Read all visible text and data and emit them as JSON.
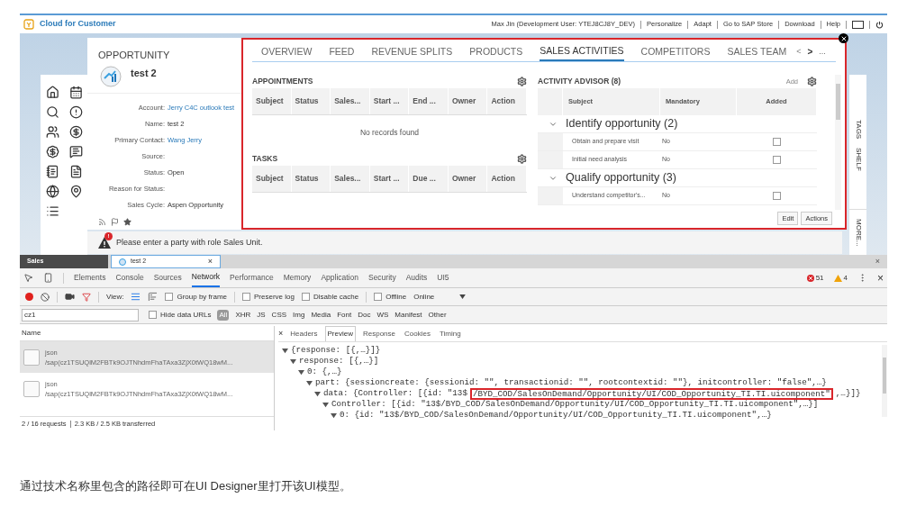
{
  "header": {
    "logo": "Cloud for Customer",
    "links": [
      "Max Jin (Development User: YTEJ8CJ8Y_DEV)",
      "Personalize",
      "Adapt",
      "Go to SAP Store",
      "Download",
      "Help"
    ]
  },
  "opportunity": {
    "heading": "OPPORTUNITY",
    "title": "test 2",
    "fields": [
      {
        "label": "Account:",
        "value": "Jerry C4C outlook test",
        "link": true
      },
      {
        "label": "Name:",
        "value": "test 2",
        "link": false
      },
      {
        "label": "Primary Contact:",
        "value": "Wang Jerry",
        "link": true
      },
      {
        "label": "Source:"
      },
      {
        "label": "Status:",
        "value": "Open",
        "link": false
      },
      {
        "label": "Reason for Status:"
      },
      {
        "label": "Sales Cycle:",
        "value": "Aspen Opportunity",
        "link": false
      }
    ]
  },
  "tabs": [
    {
      "label": "OVERVIEW",
      "selected": false
    },
    {
      "label": "FEED",
      "selected": false
    },
    {
      "label": "REVENUE SPLITS",
      "selected": false
    },
    {
      "label": "PRODUCTS",
      "selected": false
    },
    {
      "label": "SALES ACTIVITIES",
      "selected": true
    },
    {
      "label": "COMPETITORS",
      "selected": false
    },
    {
      "label": "SALES TEAM",
      "selected": false
    }
  ],
  "tab_nav": [
    "<",
    ">",
    "..."
  ],
  "appointments": {
    "title": "APPOINTMENTS",
    "columns": [
      "Subject",
      "Status",
      "Sales...",
      "Start ...",
      "End ...",
      "Owner",
      "Action"
    ],
    "empty": "No records found"
  },
  "tasks": {
    "title": "TASKS",
    "columns": [
      "Subject",
      "Status",
      "Sales...",
      "Start ...",
      "Due ...",
      "Owner",
      "Action"
    ]
  },
  "activity_advisor": {
    "title": "ACTIVITY ADVISOR (8)",
    "add": "Add",
    "columns": [
      "Subject",
      "Mandatory",
      "Added"
    ],
    "groups": [
      {
        "title": "Identify opportunity (2)",
        "expanded": true,
        "items": [
          {
            "subject": "Obtain and prepare visit",
            "mandatory": "No",
            "added": false
          },
          {
            "subject": "Initial need analysis",
            "mandatory": "No",
            "added": false
          }
        ]
      },
      {
        "title": "Qualify opportunity (3)",
        "expanded": true,
        "items": [
          {
            "subject": "Understand competitor's...",
            "mandatory": "No",
            "added": false
          }
        ]
      }
    ]
  },
  "buttons": [
    "Edit",
    "Actions"
  ],
  "side_tabs": [
    "TAGS",
    "SHELF",
    "MORE..."
  ],
  "message": {
    "text": "Please enter a party with role Sales Unit.",
    "badge": "!"
  },
  "browser_tabs": [
    {
      "label": "Sales",
      "selected": false
    },
    {
      "label": "test 2",
      "selected": true
    }
  ],
  "browser_tab_close": "×",
  "strip_close": "×",
  "devtools": {
    "tabs": [
      {
        "label": "Elements",
        "selected": false
      },
      {
        "label": "Console",
        "selected": false
      },
      {
        "label": "Sources",
        "selected": false
      },
      {
        "label": "Network",
        "selected": true
      },
      {
        "label": "Performance",
        "selected": false
      },
      {
        "label": "Memory",
        "selected": false
      },
      {
        "label": "Application",
        "selected": false
      },
      {
        "label": "Security",
        "selected": false
      },
      {
        "label": "Audits",
        "selected": false
      },
      {
        "label": "UI5",
        "selected": false
      }
    ],
    "errors": "51",
    "warnings": "4",
    "close": "×",
    "view_label": "View:",
    "options": [
      {
        "label": "Group by frame",
        "checked": false
      },
      {
        "label": "Preserve log",
        "checked": false
      },
      {
        "label": "Disable cache",
        "checked": false
      },
      {
        "label": "Offline",
        "checked": false
      }
    ],
    "throttle": "Online",
    "filter": "cz1",
    "hide_data_urls": {
      "label": "Hide data URLs",
      "checked": false
    },
    "types": [
      {
        "label": "All",
        "selected": true
      },
      {
        "label": "XHR",
        "selected": false
      },
      {
        "label": "JS",
        "selected": false
      },
      {
        "label": "CSS",
        "selected": false
      },
      {
        "label": "Img",
        "selected": false
      },
      {
        "label": "Media",
        "selected": false
      },
      {
        "label": "Font",
        "selected": false
      },
      {
        "label": "Doc",
        "selected": false
      },
      {
        "label": "WS",
        "selected": false
      },
      {
        "label": "Manifest",
        "selected": false
      },
      {
        "label": "Other",
        "selected": false
      }
    ],
    "name_header": "Name",
    "requests": [
      {
        "name": "json",
        "path": "/sap(cz1TSUQlM2FBTk9OJTNhdmFhaTAxa3ZjX0tWQ18wM...",
        "selected": true
      },
      {
        "name": "json",
        "path": "/sap(cz1TSUQlM2FBTk9OJTNhdmFhaTAxa3ZjX0tWQ18wM...",
        "selected": false
      }
    ],
    "summary": [
      "2 / 16 requests",
      "2.3 KB / 2.5 KB transferred"
    ],
    "preview_close": "×",
    "preview_tabs": [
      {
        "label": "Headers",
        "selected": false
      },
      {
        "label": "Preview",
        "selected": true
      },
      {
        "label": "Response",
        "selected": false
      },
      {
        "label": "Cookies",
        "selected": false
      },
      {
        "label": "Timing",
        "selected": false
      }
    ],
    "tree": [
      {
        "text": "{response: [{,…}]}",
        "expanded": true,
        "children": [
          {
            "text": "response: [{,…}]",
            "expanded": true,
            "children": [
              {
                "text": "0: {,…}",
                "expanded": true,
                "children": [
                  {
                    "text": "part: {sessioncreate: {sessionid: \"\", transactionid: \"\", rootcontextid: \"\"}, initcontroller: \"false\",…}",
                    "expanded": true,
                    "children": [
                      {
                        "text": "data: {Controller: [{id: \"13$",
                        "highlight": "/BYD_COD/SalesOnDemand/Opportunity/UI/COD_Opportunity_TI.TI.uicomponent\"",
                        "after": ",…}]}",
                        "expanded": true,
                        "children": [
                          {
                            "text": "Controller: [{id: \"13$/BYD_COD/SalesOnDemand/Opportunity/UI/COD_Opportunity_TI.TI.uicomponent\",…}]",
                            "expanded": true,
                            "children": [
                              {
                                "text": "0: {id: \"13$/BYD_COD/SalesOnDemand/Opportunity/UI/COD_Opportunity_TI.TI.uicomponent\",…}",
                                "expanded": true
                              }
                            ]
                          }
                        ]
                      }
                    ]
                  }
                ]
              }
            ]
          }
        ]
      }
    ]
  },
  "caption": "通过技术名称里包含的路径即可在UI Designer里打开该UI模型。"
}
